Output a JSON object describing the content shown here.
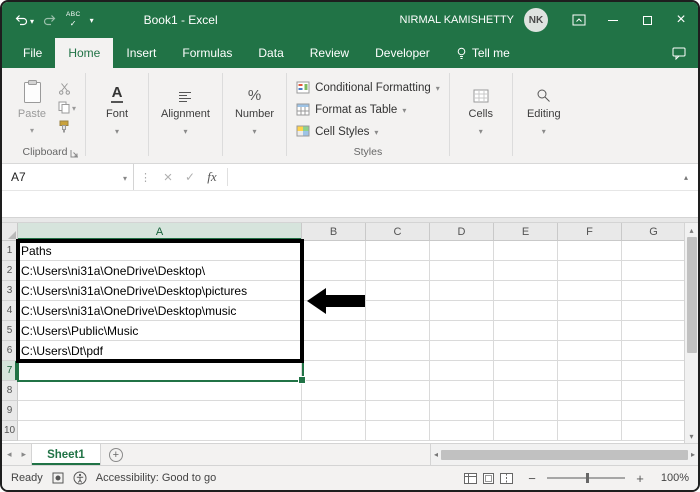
{
  "colors": {
    "accent": "#217346"
  },
  "titlebar": {
    "title": "Book1 - Excel",
    "user_name": "NIRMAL KAMISHETTY",
    "user_initials": "NK"
  },
  "ribbon_tabs": {
    "items": [
      "File",
      "Home",
      "Insert",
      "Formulas",
      "Data",
      "Review",
      "Developer"
    ],
    "active": "Home",
    "tell_me": "Tell me"
  },
  "ribbon": {
    "paste": "Paste",
    "clipboard_label": "Clipboard",
    "font": "Font",
    "alignment": "Alignment",
    "number": "Number",
    "styles_items": [
      "Conditional Formatting",
      "Format as Table",
      "Cell Styles"
    ],
    "styles_label": "Styles",
    "cells": "Cells",
    "editing": "Editing"
  },
  "icons": {
    "font_glyph": "A",
    "number_glyph": "%",
    "spelling_glyph": "ABC"
  },
  "formula_bar": {
    "name_box": "A7",
    "fx_label": "fx",
    "formula_value": ""
  },
  "grid": {
    "columns": [
      "A",
      "B",
      "C",
      "D",
      "E",
      "F",
      "G"
    ],
    "row_numbers": [
      "1",
      "2",
      "3",
      "4",
      "5",
      "6",
      "7",
      "8",
      "9",
      "10"
    ],
    "a_values": [
      "Paths",
      "C:\\Users\\ni31a\\OneDrive\\Desktop\\",
      "C:\\Users\\ni31a\\OneDrive\\Desktop\\pictures",
      "C:\\Users\\ni31a\\OneDrive\\Desktop\\music",
      "C:\\Users\\Public\\Music",
      "C:\\Users\\Dt\\pdf"
    ],
    "selected_cell": "A7",
    "selected_column": "A",
    "selected_row": "7"
  },
  "sheet_bar": {
    "active_sheet": "Sheet1"
  },
  "status_bar": {
    "mode": "Ready",
    "accessibility": "Accessibility: Good to go",
    "zoom_level": "100%"
  }
}
